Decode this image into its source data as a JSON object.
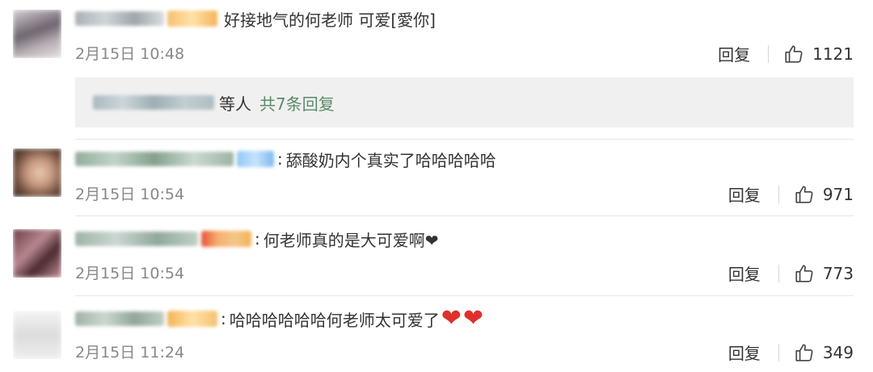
{
  "comments": [
    {
      "text": "好接地气的何老师 可爱[愛你]",
      "time": "2月15日 10:48",
      "reply_label": "回复",
      "likes": "1121",
      "avatar_colors": [
        "#c9c0c4",
        "#6e6470",
        "#e6e0e4"
      ]
    },
    {
      "text": "舔酸奶内个真实了哈哈哈哈哈",
      "time": "2月15日 10:54",
      "reply_label": "回复",
      "likes": "971",
      "avatar_colors": [
        "#d9b9a0",
        "#8a6a5a",
        "#f2e2d2"
      ]
    },
    {
      "text": "何老师真的是大可爱啊❤",
      "time": "2月15日 10:54",
      "reply_label": "回复",
      "likes": "773",
      "avatar_colors": [
        "#8a5a60",
        "#4a2a30",
        "#c49098"
      ]
    },
    {
      "text": "哈哈哈哈哈哈何老师太可爱了",
      "time": "2月15日 11:24",
      "reply_label": "回复",
      "likes": "349",
      "avatar_colors": [
        "#ececec",
        "#d0d0d0",
        "#f8f8f8"
      ]
    }
  ],
  "reply_box": {
    "others": "等人",
    "more_link": "共7条回复"
  },
  "colors": {
    "link_green": "#5b8a6a",
    "meta_gray": "#888888",
    "reply_bg": "#f0f0f0",
    "heart_red": "#e0302b"
  },
  "icons": {
    "like": "thumbs-up-outline-icon",
    "heart": "red-heart-emoji"
  }
}
